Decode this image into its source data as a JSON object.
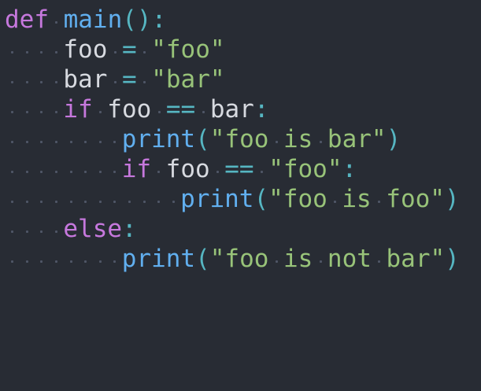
{
  "editor": {
    "background": "#282c34",
    "language": "python",
    "lines": [
      {
        "indent": 0,
        "tokens": [
          {
            "kind": "keyword",
            "text": "def"
          },
          {
            "kind": "space",
            "text": " "
          },
          {
            "kind": "func",
            "text": "main"
          },
          {
            "kind": "punct",
            "text": "():"
          }
        ]
      },
      {
        "indent": 4,
        "tokens": [
          {
            "kind": "ident",
            "text": "foo"
          },
          {
            "kind": "space",
            "text": " "
          },
          {
            "kind": "op",
            "text": "="
          },
          {
            "kind": "space",
            "text": " "
          },
          {
            "kind": "string",
            "text": "\"foo\""
          }
        ]
      },
      {
        "indent": 4,
        "tokens": [
          {
            "kind": "ident",
            "text": "bar"
          },
          {
            "kind": "space",
            "text": " "
          },
          {
            "kind": "op",
            "text": "="
          },
          {
            "kind": "space",
            "text": " "
          },
          {
            "kind": "string",
            "text": "\"bar\""
          }
        ]
      },
      {
        "indent": 4,
        "tokens": [
          {
            "kind": "keyword",
            "text": "if"
          },
          {
            "kind": "space",
            "text": " "
          },
          {
            "kind": "ident",
            "text": "foo"
          },
          {
            "kind": "space",
            "text": " "
          },
          {
            "kind": "op",
            "text": "=="
          },
          {
            "kind": "space",
            "text": " "
          },
          {
            "kind": "ident",
            "text": "bar"
          },
          {
            "kind": "punct",
            "text": ":"
          }
        ]
      },
      {
        "indent": 8,
        "tokens": [
          {
            "kind": "func",
            "text": "print"
          },
          {
            "kind": "punct",
            "text": "("
          },
          {
            "kind": "string",
            "text": "\"foo"
          },
          {
            "kind": "space",
            "text": " "
          },
          {
            "kind": "string",
            "text": "is"
          },
          {
            "kind": "space",
            "text": " "
          },
          {
            "kind": "string",
            "text": "bar\""
          },
          {
            "kind": "punct",
            "text": ")"
          }
        ]
      },
      {
        "indent": 8,
        "tokens": [
          {
            "kind": "keyword",
            "text": "if"
          },
          {
            "kind": "space",
            "text": " "
          },
          {
            "kind": "ident",
            "text": "foo"
          },
          {
            "kind": "space",
            "text": " "
          },
          {
            "kind": "op",
            "text": "=="
          },
          {
            "kind": "space",
            "text": " "
          },
          {
            "kind": "string",
            "text": "\"foo\""
          },
          {
            "kind": "punct",
            "text": ":"
          }
        ]
      },
      {
        "indent": 12,
        "tokens": [
          {
            "kind": "func",
            "text": "print"
          },
          {
            "kind": "punct",
            "text": "("
          },
          {
            "kind": "string",
            "text": "\"foo"
          },
          {
            "kind": "space",
            "text": " "
          },
          {
            "kind": "string",
            "text": "is"
          },
          {
            "kind": "space",
            "text": " "
          },
          {
            "kind": "string",
            "text": "foo\""
          },
          {
            "kind": "punct",
            "text": ")"
          }
        ]
      },
      {
        "indent": 4,
        "tokens": [
          {
            "kind": "keyword",
            "text": "else"
          },
          {
            "kind": "punct",
            "text": ":"
          }
        ]
      },
      {
        "indent": 8,
        "tokens": [
          {
            "kind": "func",
            "text": "print"
          },
          {
            "kind": "punct",
            "text": "("
          },
          {
            "kind": "string",
            "text": "\"foo"
          },
          {
            "kind": "space",
            "text": " "
          },
          {
            "kind": "string",
            "text": "is"
          },
          {
            "kind": "space",
            "text": " "
          },
          {
            "kind": "string",
            "text": "not"
          },
          {
            "kind": "space",
            "text": " "
          },
          {
            "kind": "string",
            "text": "bar\""
          },
          {
            "kind": "punct",
            "text": ")"
          }
        ]
      }
    ]
  },
  "colors": {
    "keyword": "#c678dd",
    "func": "#61afef",
    "string": "#98c379",
    "punct": "#56b6c2",
    "ident": "#d7dae0",
    "whitespace_dot": "#4f5666"
  }
}
